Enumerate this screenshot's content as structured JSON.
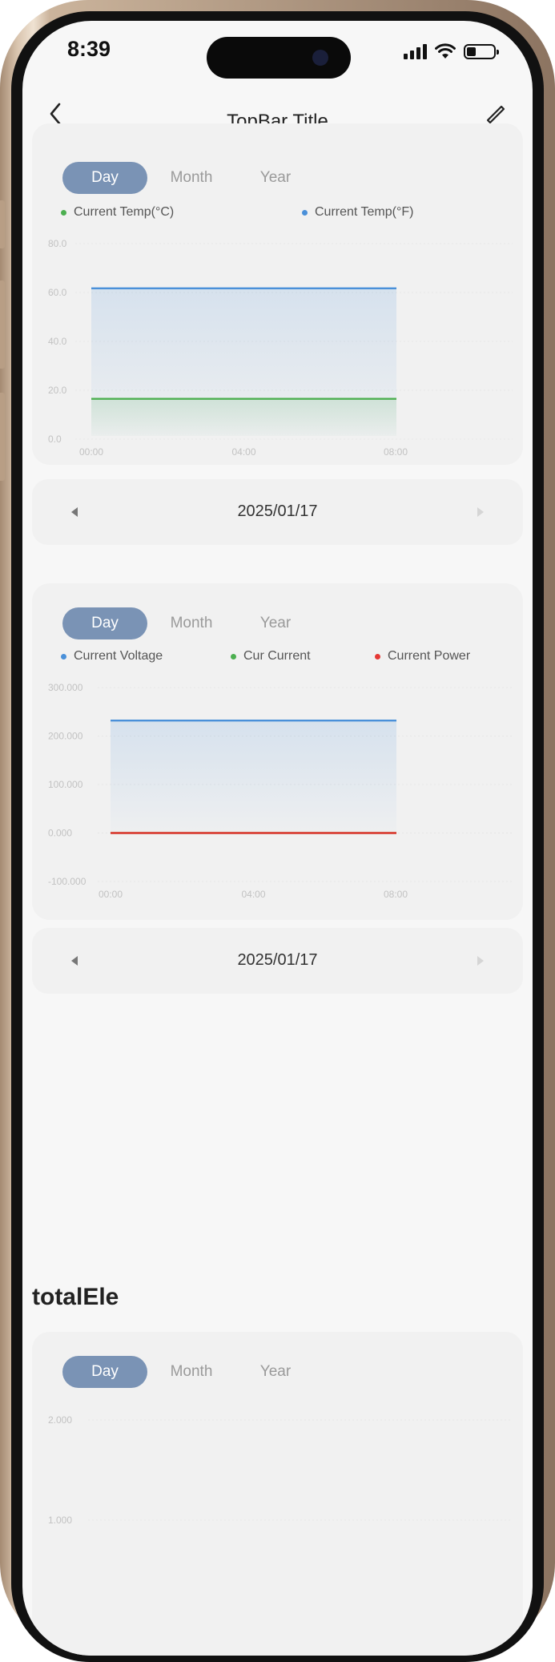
{
  "status_bar": {
    "time": "8:39"
  },
  "top_bar": {
    "title": "TopBar Title"
  },
  "tabs": {
    "day": "Day",
    "month": "Month",
    "year": "Year"
  },
  "temp_card": {
    "legend": [
      "Current Temp(°C)",
      "Current Temp(°F)"
    ],
    "date": "2025/01/17",
    "chart_data": {
      "type": "area",
      "x": [
        "00:00",
        "04:00",
        "08:00"
      ],
      "y_ticks": [
        "80.0",
        "60.0",
        "40.0",
        "20.0",
        "0.0"
      ],
      "ylim": [
        0,
        80
      ],
      "series": [
        {
          "name": "Current Temp(°C)",
          "color": "#4caf50",
          "values": [
            16.5,
            16.5,
            16.5
          ]
        },
        {
          "name": "Current Temp(°F)",
          "color": "#4a90d9",
          "values": [
            61.7,
            61.7,
            61.7
          ]
        }
      ]
    }
  },
  "power_card": {
    "legend": [
      "Current Voltage",
      "Cur Current",
      "Current Power"
    ],
    "date": "2025/01/17",
    "chart_data": {
      "type": "area",
      "x": [
        "00:00",
        "04:00",
        "08:00"
      ],
      "y_ticks": [
        "300.000",
        "200.000",
        "100.000",
        "0.000",
        "-100.000"
      ],
      "ylim": [
        -100,
        300
      ],
      "series": [
        {
          "name": "Current Voltage",
          "color": "#4a90d9",
          "values": [
            232,
            232,
            232
          ]
        },
        {
          "name": "Cur Current",
          "color": "#4caf50",
          "values": [
            0,
            0,
            0
          ]
        },
        {
          "name": "Current Power",
          "color": "#e53935",
          "values": [
            0,
            0,
            0
          ]
        }
      ]
    }
  },
  "total_card": {
    "title": "totalEle",
    "chart_data": {
      "type": "line",
      "y_ticks": [
        "2.000",
        "1.000"
      ],
      "ylim": [
        0,
        2
      ]
    }
  },
  "colors": {
    "accent": "#7a93b5",
    "card": "#f1f1f1",
    "background": "#f7f7f7"
  }
}
